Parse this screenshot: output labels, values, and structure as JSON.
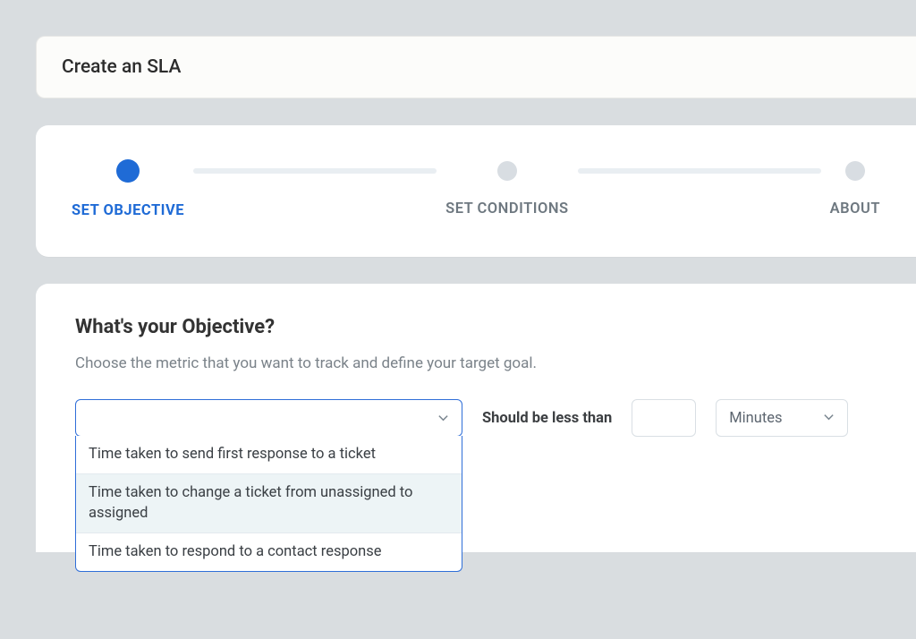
{
  "header": {
    "title": "Create an SLA"
  },
  "stepper": {
    "steps": [
      {
        "label": "SET OBJECTIVE",
        "active": true
      },
      {
        "label": "SET CONDITIONS",
        "active": false
      },
      {
        "label": "ABOUT",
        "active": false
      }
    ]
  },
  "objective": {
    "heading": "What's your Objective?",
    "subtext": "Choose the metric that you want to track and define your target goal.",
    "metric_dropdown": {
      "selected": "",
      "options": [
        "Time taken to send first response to a ticket",
        "Time taken to change a ticket from unassigned to assigned",
        "Time taken to respond to a contact response"
      ],
      "highlighted_index": 1
    },
    "comparison_label": "Should be less than",
    "value_input": "",
    "unit_select": {
      "selected": "Minutes"
    }
  }
}
